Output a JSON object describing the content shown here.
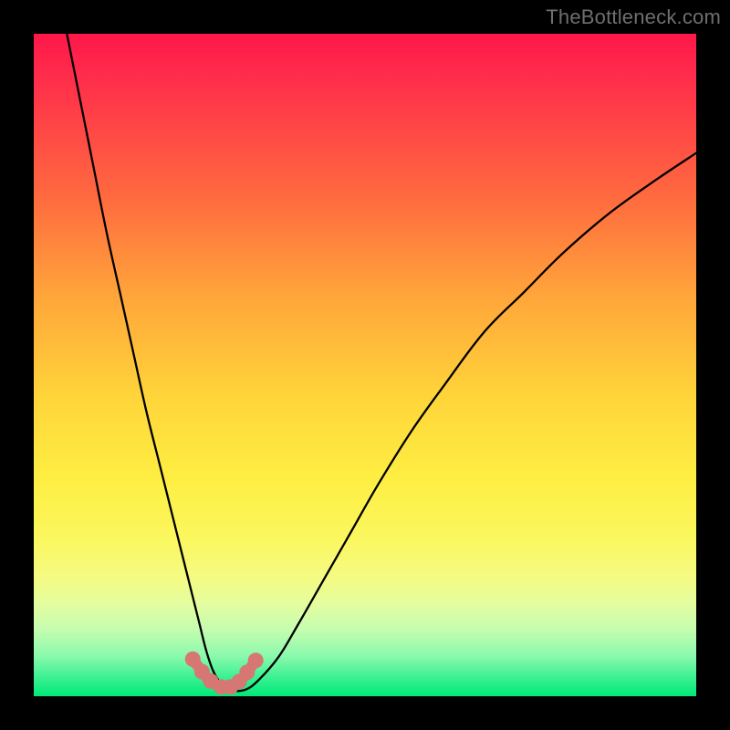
{
  "watermark": "TheBottleneck.com",
  "chart_data": {
    "type": "line",
    "title": "",
    "xlabel": "",
    "ylabel": "",
    "xlim": [
      0,
      100
    ],
    "ylim": [
      0,
      100
    ],
    "grid": false,
    "series": [
      {
        "name": "curve",
        "color": "#000000",
        "x": [
          5,
          7,
          9,
          11,
          13,
          15,
          17,
          19,
          21,
          23,
          24,
          25,
          26,
          27,
          28,
          29,
          30,
          32,
          34,
          37,
          40,
          44,
          48,
          52,
          57,
          62,
          68,
          74,
          80,
          87,
          94,
          100
        ],
        "values": [
          100,
          90,
          80,
          70,
          61,
          52,
          43,
          35,
          27,
          19,
          15,
          11,
          7,
          4,
          2.2,
          1.2,
          0.8,
          1.0,
          2.5,
          6,
          11,
          18,
          25,
          32,
          40,
          47,
          55,
          61,
          67,
          73,
          78,
          82
        ]
      },
      {
        "name": "markers",
        "color": "#d67773",
        "type": "scatter",
        "x": [
          24.0,
          25.4,
          26.7,
          28.3,
          29.7,
          31.0,
          32.2,
          33.5
        ],
        "values": [
          5.6,
          3.7,
          2.3,
          1.4,
          1.4,
          2.2,
          3.6,
          5.4
        ]
      }
    ],
    "background_gradient": {
      "top": "#ff1749",
      "mid": "#feee42",
      "bottom": "#00e977"
    }
  }
}
